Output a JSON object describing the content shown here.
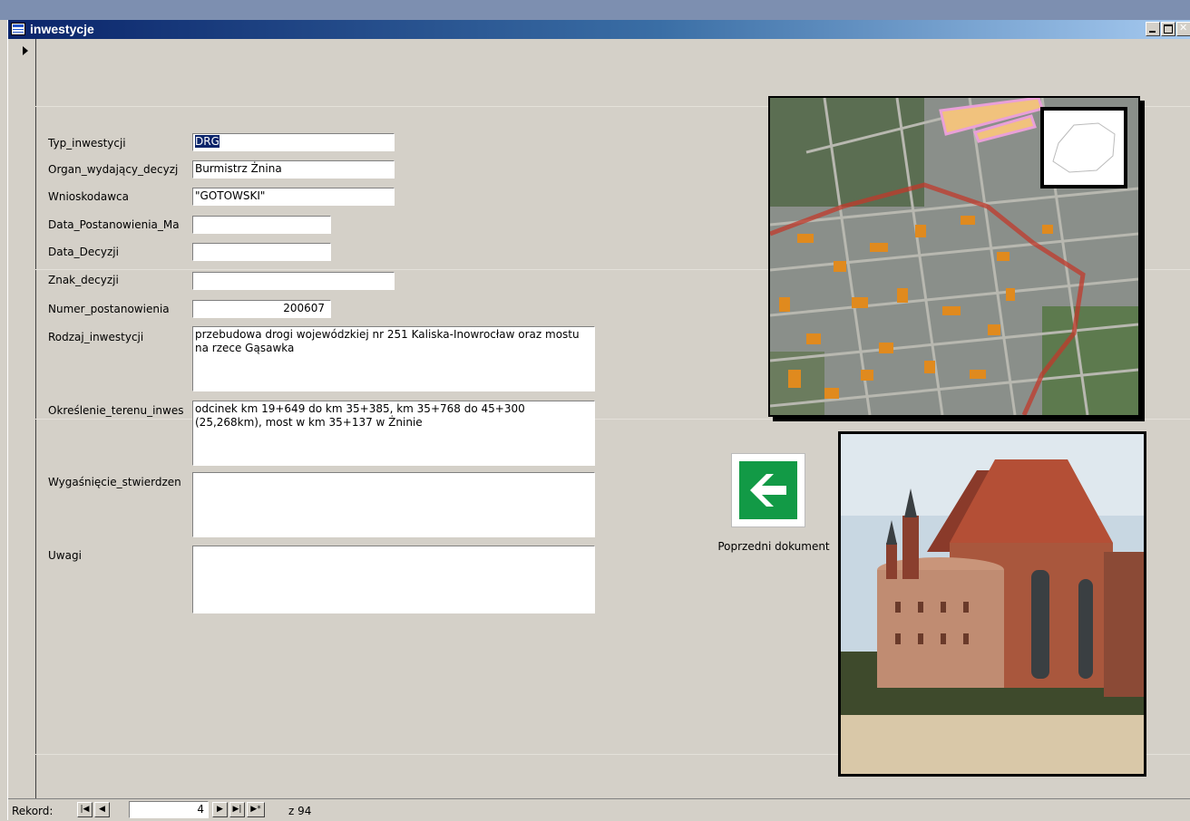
{
  "window": {
    "title": "inwestycje"
  },
  "fields": [
    {
      "label": "Typ_inwestycji",
      "value": "DRG"
    },
    {
      "label": "Organ_wydający_decyzj",
      "value": "Burmistrz Żnina"
    },
    {
      "label": "Wnioskodawca",
      "value": "\"GOTOWSKI\""
    },
    {
      "label": "Data_Postanowienia_Ma",
      "value": ""
    },
    {
      "label": "Data_Decyzji",
      "value": ""
    },
    {
      "label": "Znak_decyzji",
      "value": ""
    },
    {
      "label": "Numer_postanowienia",
      "value": "200607"
    },
    {
      "label": "Rodzaj_inwestycji",
      "value": "przebudowa drogi wojewódzkiej nr 251 Kaliska-Inowrocław oraz mostu na rzece Gąsawka"
    },
    {
      "label": "Określenie_terenu_inwes",
      "value": "odcinek km 19+649 do km 35+385, km 35+768 do 45+300 (25,268km), most w km 35+137 w Żninie"
    },
    {
      "label": "Wygaśnięcie_stwierdzen",
      "value": ""
    },
    {
      "label": "Uwagi",
      "value": ""
    }
  ],
  "prev_button": {
    "label": "Poprzedni dokument",
    "icon": "arrow-left-icon"
  },
  "navigation": {
    "label": "Rekord:",
    "current": "4",
    "of_label": "z 94",
    "buttons": [
      "first-record",
      "previous-record",
      "next-record",
      "last-record",
      "new-record"
    ]
  },
  "colors": {
    "title_gradient_start": "#0a246a",
    "title_gradient_end": "#a6caf0",
    "form_background": "#d4d0c8",
    "exit_sign_green": "#129a46"
  }
}
